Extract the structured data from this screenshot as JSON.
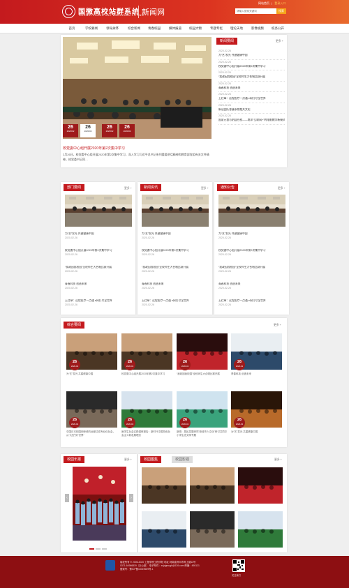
{
  "header": {
    "logo_cn": "国微高校站群系统",
    "logo_en": "GUOWEI ZHONG XUE WANGZHAN XITONG",
    "sub_title": "新闻网",
    "top_links": [
      "网站首页",
      "|",
      "登录入口"
    ],
    "search_placeholder": "请输入搜索关键词",
    "search_button": "搜索",
    "colors": {
      "brand": "#c41a1e",
      "accent": "#f6a51a",
      "footer": "#8d0f12"
    }
  },
  "nav": {
    "items": [
      "首页",
      "学校要闻",
      "领导关怀",
      "综合新闻",
      "青春校园",
      "媒体报道",
      "校园大物",
      "专题专栏",
      "理论天地",
      "影像视频",
      "校务公开"
    ],
    "active_index": 0
  },
  "hero": {
    "caption": "校党委中心组开展2020年第2次集中学习",
    "desc": "2月26日，校党委中心组开展2020年第2次集中学习，深入学习习近平总书记系列重要讲话精神和教育部党组有关文件精神。校党委书记同…",
    "dates": [
      {
        "day": "26",
        "ym": "2020/02"
      },
      {
        "day": "26",
        "ym": "2020/02"
      },
      {
        "day": "26",
        "ym": "2020/02"
      },
      {
        "day": "26",
        "ym": "2020/02"
      }
    ]
  },
  "news_focus": {
    "title": "新闻要闻",
    "more": "更多 +",
    "items": [
      {
        "date": "2020-02-26",
        "title": "为“艺”发光 共建健康中国"
      },
      {
        "date": "2020-02-26",
        "title": "校党委中心组开展2020年第2次集中学习"
      },
      {
        "date": "2020-02-26",
        "title": "“我政因我校园”全校师生大合唱比赛开展"
      },
      {
        "date": "2020-02-26",
        "title": "青春科技 创造未来"
      },
      {
        "date": "2020-02-26",
        "title": "王红章：远程医疗一点通 e网打尽全世界"
      },
      {
        "date": "2020-02-26",
        "title": "新冠团队答疑系统相关文化"
      },
      {
        "date": "2020-02-26",
        "title": "国家元首与阴县任校——南洋“互联网+”的电影教学新模式"
      }
    ]
  },
  "columns": [
    {
      "title": "部门要闻",
      "more": "更多 +",
      "items": [
        {
          "title": "为“艺”发光 共建健康中国",
          "date": "2020-02-26"
        },
        {
          "title": "校党委中心组开展2020年第2次集中学习",
          "date": "2020-02-26"
        },
        {
          "title": "“我政因我校园”全校师生大合唱比赛开展",
          "date": "2020-02-26"
        },
        {
          "title": "青春科技 创造未来",
          "date": "2020-02-26"
        },
        {
          "title": "王红章：远程医疗一点通 e网打尽全世界",
          "date": "2020-02-26"
        }
      ]
    },
    {
      "title": "新闻资讯",
      "more": "更多 +",
      "items": [
        {
          "title": "为“艺”发光 共建健康中国",
          "date": "2020-02-26"
        },
        {
          "title": "校党委中心组开展2020年第2次集中学习",
          "date": "2020-02-26"
        },
        {
          "title": "“我政因我校园”全校师生大合唱比赛开展",
          "date": "2020-02-26"
        },
        {
          "title": "青春科技 创造未来",
          "date": "2020-02-26"
        },
        {
          "title": "王红章：远程医疗一点通 e网打尽全世界",
          "date": "2020-02-26"
        }
      ]
    },
    {
      "title": "通知公告",
      "more": "更多 +",
      "items": [
        {
          "title": "为“艺”发光 共建健康中国",
          "date": "2020-02-26"
        },
        {
          "title": "校党委中心组开展2020年第2次集中学习",
          "date": "2020-02-26"
        },
        {
          "title": "“我政因我校园”全校师生大合唱比赛开展",
          "date": "2020-02-26"
        },
        {
          "title": "青春科技 创造未来",
          "date": "2020-02-26"
        },
        {
          "title": "王红章：远程医疗一点通 e网打尽全世界",
          "date": "2020-02-26"
        }
      ]
    }
  ],
  "composite": {
    "title": "综合要闻",
    "more": "更多 +",
    "cards": [
      {
        "day": "26",
        "ym": "2020-02",
        "caption": "为“艺”发光 共建健康中国"
      },
      {
        "day": "26",
        "ym": "2020-02",
        "caption": "校党委中心组开展2020年第2次集中学习"
      },
      {
        "day": "26",
        "ym": "2020-02",
        "caption": "“我政因我校园”全校师生大合唱比赛开展"
      },
      {
        "day": "26",
        "ym": "2020-02",
        "caption": "青春科技 创造未来"
      },
      {
        "day": "26",
        "ym": "2020-02",
        "caption": "中国日本校园网师资的远程达成专业化社会，从“大型”到“世界”"
      },
      {
        "day": "26",
        "ym": "2020-02",
        "caption": "医学生社会实践调研报告：新时代中国特色社会主义新发展理念"
      },
      {
        "day": "26",
        "ym": "2020-02",
        "caption": "新闻：居民发展研究“新城市人文化”研讨共同中小学生态文明专题"
      },
      {
        "day": "26",
        "ym": "2020-02",
        "caption": "为“艺”发光 共建健康中国"
      }
    ]
  },
  "bottom": {
    "left_title": "校园年报",
    "left_more": "更多 +",
    "tabs": [
      "校园图集",
      "校园影视"
    ],
    "right_more": "更多 +",
    "arrow_left": "‹",
    "arrow_right": "›"
  },
  "footer": {
    "lines": [
      "版权所有 © 2006-2020 工程学院工程学校 地址:河南省郑州市郑上路11号",
      "0371-64966819（办公室） 电子邮件：xxjdgrsugh@126.com 邮编：450121",
      "备案号：豫ICP备16019669号-1"
    ],
    "qr_caption": "关注我们"
  }
}
